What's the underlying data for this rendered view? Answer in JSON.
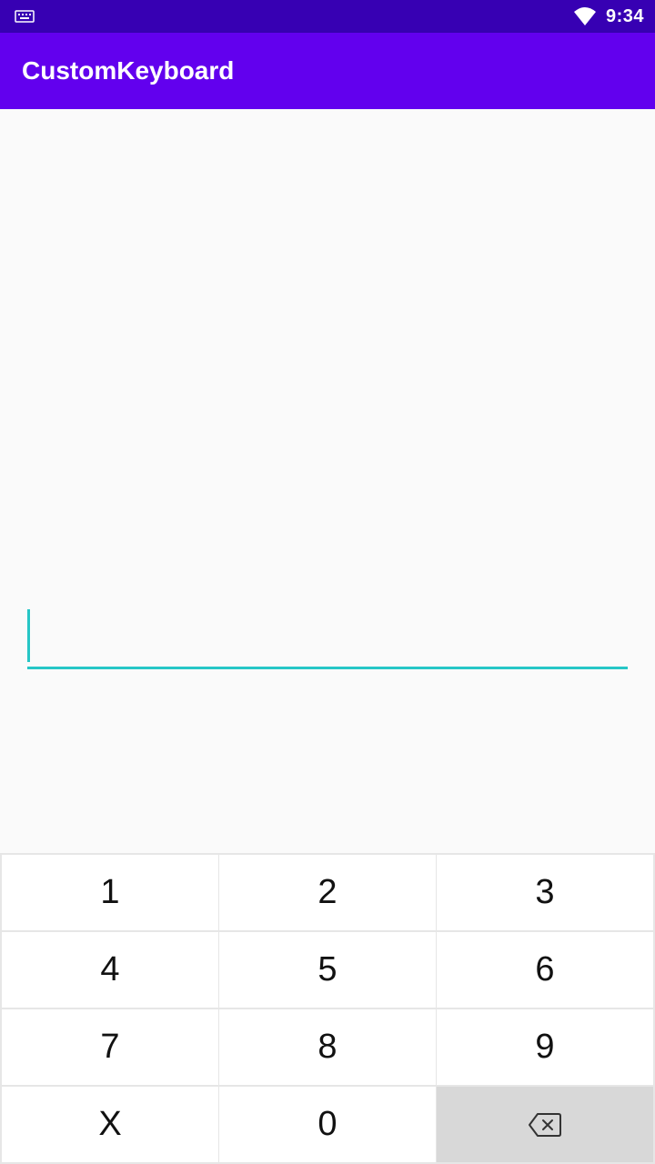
{
  "status_bar": {
    "left_icon": "keyboard-icon",
    "wifi_icon": "wifi-icon",
    "time": "9:34"
  },
  "app_bar": {
    "title": "CustomKeyboard"
  },
  "input": {
    "value": ""
  },
  "keyboard": {
    "rows": [
      [
        "1",
        "2",
        "3"
      ],
      [
        "4",
        "5",
        "6"
      ],
      [
        "7",
        "8",
        "9"
      ],
      [
        "X",
        "0",
        ""
      ]
    ],
    "backspace_icon": "backspace-icon"
  },
  "colors": {
    "status_bar": "#3700b3",
    "app_bar": "#6200ee",
    "accent": "#26c6c6"
  }
}
